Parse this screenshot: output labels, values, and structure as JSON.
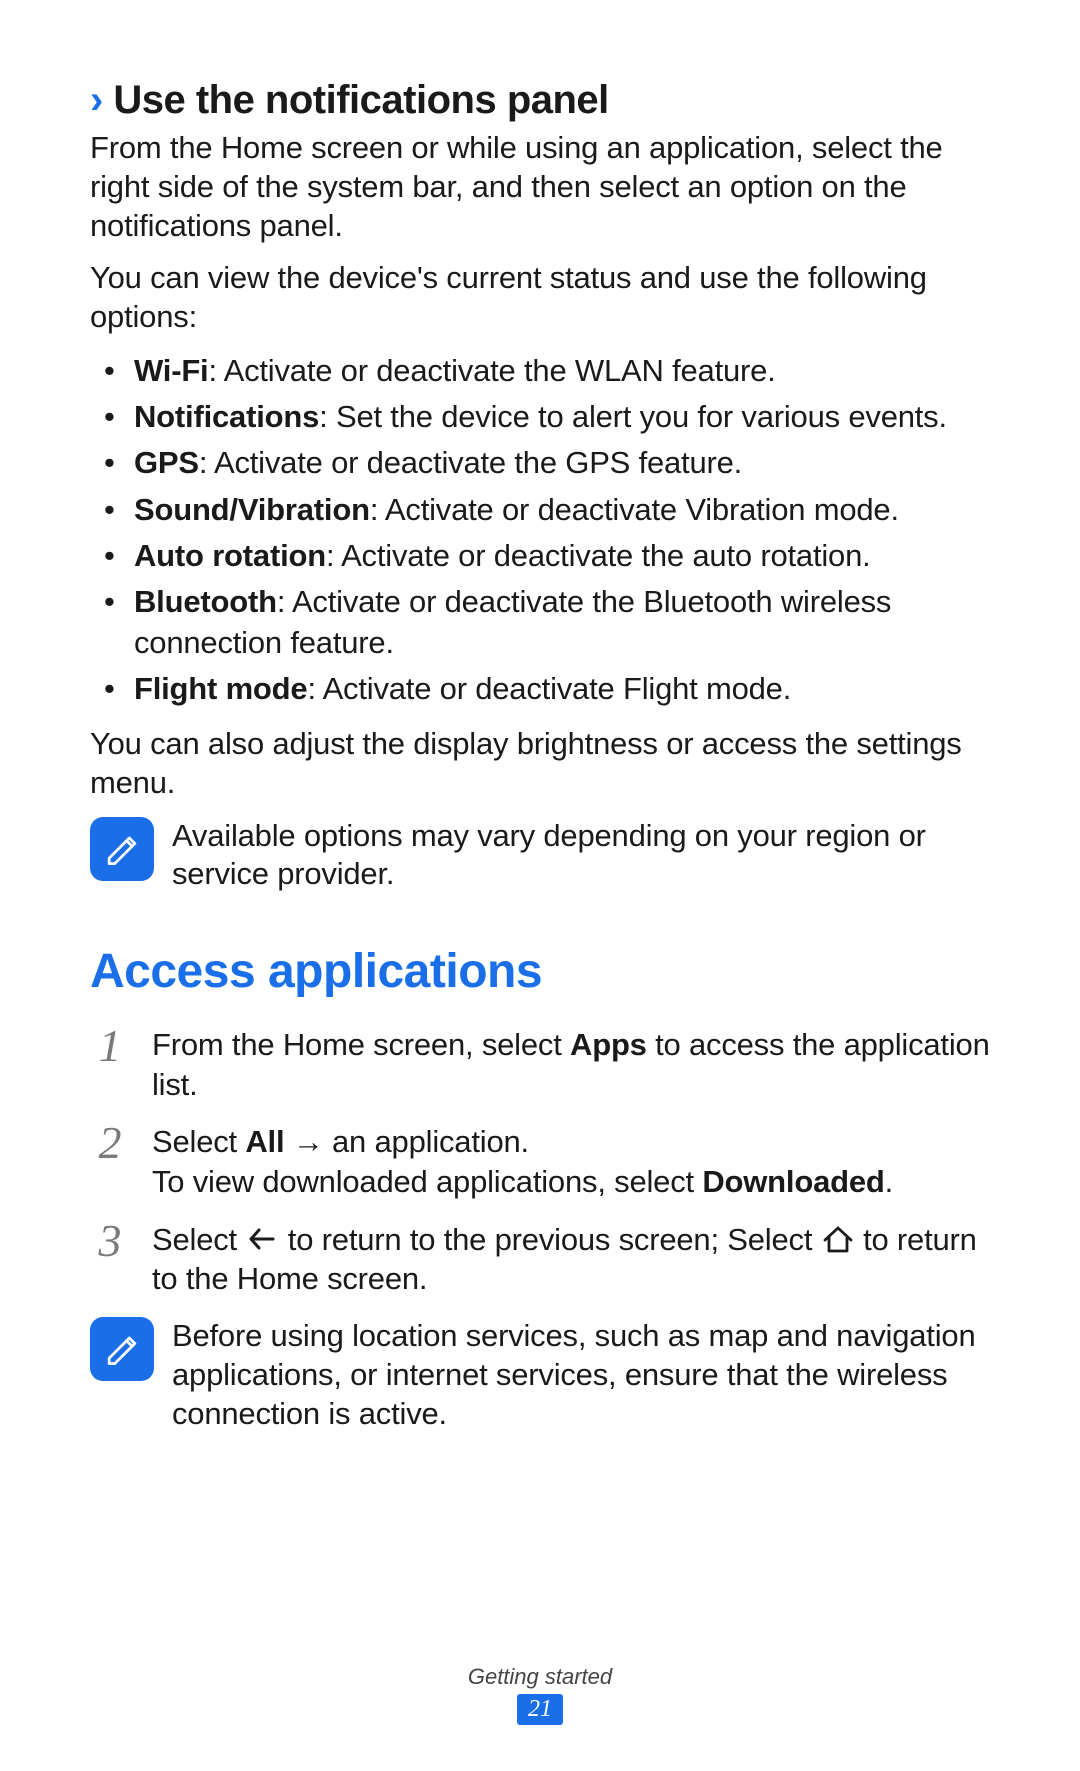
{
  "section1": {
    "chevron": "›",
    "title": "Use the notifications panel",
    "para1": "From the Home screen or while using an application, select the right side of the system bar, and then select an option on the notifications panel.",
    "para2": "You can view the device's current status and use the following options:",
    "bullets": [
      {
        "term": "Wi-Fi",
        "desc": ": Activate or deactivate the WLAN feature."
      },
      {
        "term": "Notifications",
        "desc": ": Set the device to alert you for various events."
      },
      {
        "term": "GPS",
        "desc": ": Activate or deactivate the GPS feature."
      },
      {
        "term": "Sound/Vibration",
        "desc": ": Activate or deactivate Vibration mode."
      },
      {
        "term": "Auto rotation",
        "desc": ": Activate or deactivate the auto rotation."
      },
      {
        "term": "Bluetooth",
        "desc": ": Activate or deactivate the Bluetooth wireless connection feature."
      },
      {
        "term": "Flight mode",
        "desc": ": Activate or deactivate Flight mode."
      }
    ],
    "para3": "You can also adjust the display brightness or access the settings menu.",
    "note": "Available options may vary depending on your region or service provider."
  },
  "section2": {
    "title": "Access applications",
    "steps": {
      "n1": "1",
      "s1a": "From the Home screen, select ",
      "s1b": "Apps",
      "s1c": " to access the application list.",
      "n2": "2",
      "s2a": "Select ",
      "s2b": "All",
      "s2c": " → an application.",
      "s2d": "To view downloaded applications, select ",
      "s2e": "Downloaded",
      "s2f": ".",
      "n3": "3",
      "s3a": "Select ",
      "s3b": " to return to the previous screen; Select ",
      "s3c": " to return to the Home screen."
    },
    "note": "Before using location services, such as map and navigation applications, or internet services, ensure that the wireless connection is active."
  },
  "footer": {
    "section": "Getting started",
    "page": "21"
  },
  "icons": {
    "note": "note-pencil-icon",
    "back": "back-arrow-icon",
    "home": "home-icon"
  }
}
